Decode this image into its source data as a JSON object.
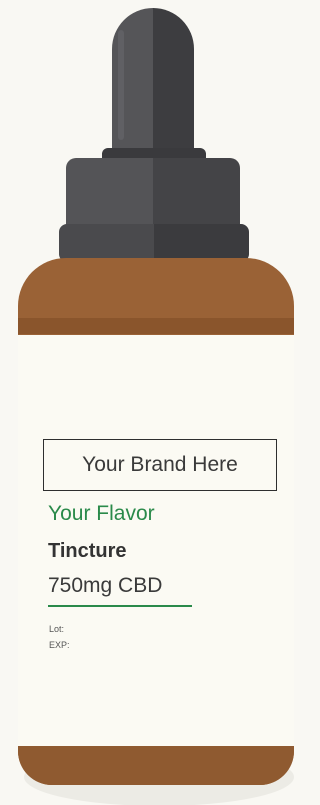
{
  "label": {
    "brand": "Your Brand Here",
    "flavor": "Your Flavor",
    "product_type": "Tincture",
    "strength": "750mg CBD",
    "lot": "Lot:",
    "exp": "EXP:"
  },
  "colors": {
    "background": "#f9f8f3",
    "dropper": "#4a4a4d",
    "bottle_glass": "#9a6236",
    "label_paper": "#fbfaf3",
    "accent_green": "#2a8a4a"
  }
}
